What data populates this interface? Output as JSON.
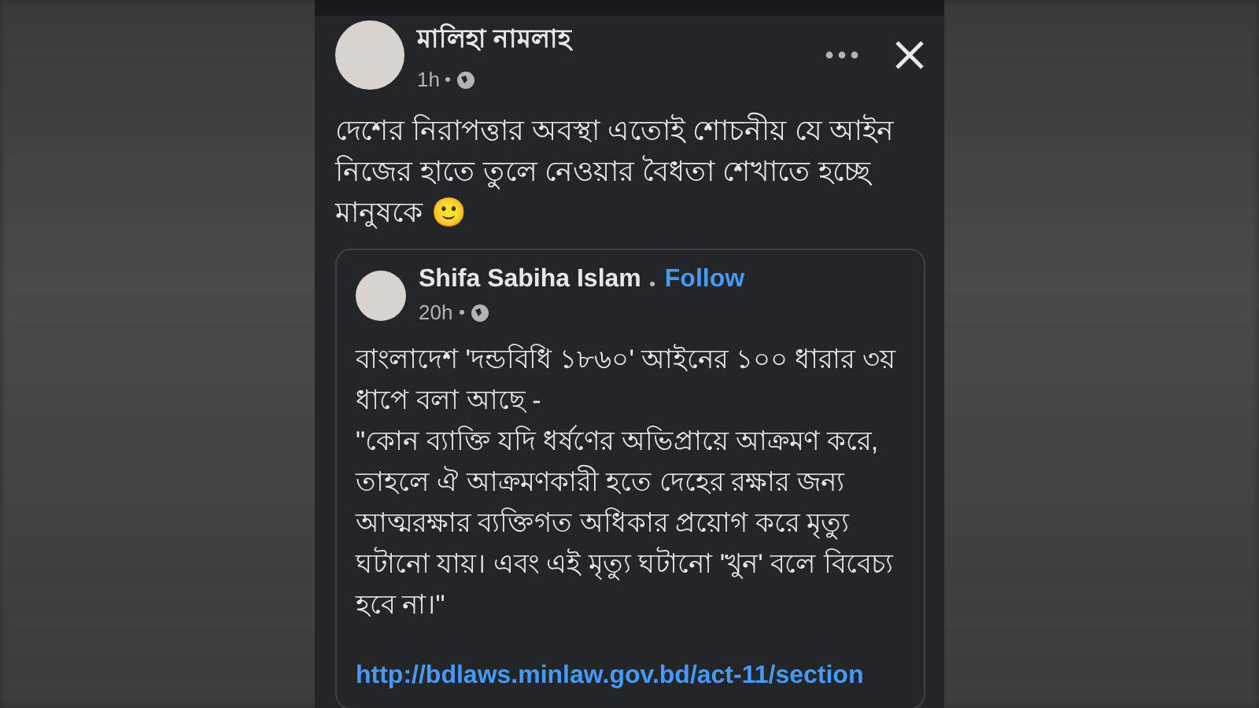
{
  "post": {
    "author": "মালিহা নামলাহ",
    "time": "1h",
    "text": "দেশের নিরাপত্তার অবস্থা এতোই শোচনীয় যে আইন নিজের হাতে তুলে নেওয়ার বৈধতা শেখাতে হচ্ছে মানুষকে",
    "emoji": "🙂"
  },
  "shared_post": {
    "author": "Shifa Sabiha Islam",
    "follow": "Follow",
    "time": "20h",
    "paragraphs": [
      "বাংলাদেশ 'দন্ডবিধি ১৮৬০' আইনের ১০০ ধারার ৩য় ধাপে বলা আছে -",
      "\"কোন ব্যাক্তি যদি ধর্ষণের অভিপ্রায়ে আক্রমণ করে, তাহলে ঐ আক্রমণকারী হতে দেহের রক্ষার জন্য আত্মরক্ষার ব্যক্তিগত অধিকার প্রয়োগ করে মৃত্যু ঘটানো যায়। এবং এই মৃত্যু ঘটানো 'খুন' বলে বিবেচ্য হবে না।\""
    ],
    "link": "http://bdlaws.minlaw.gov.bd/act-11/section"
  }
}
